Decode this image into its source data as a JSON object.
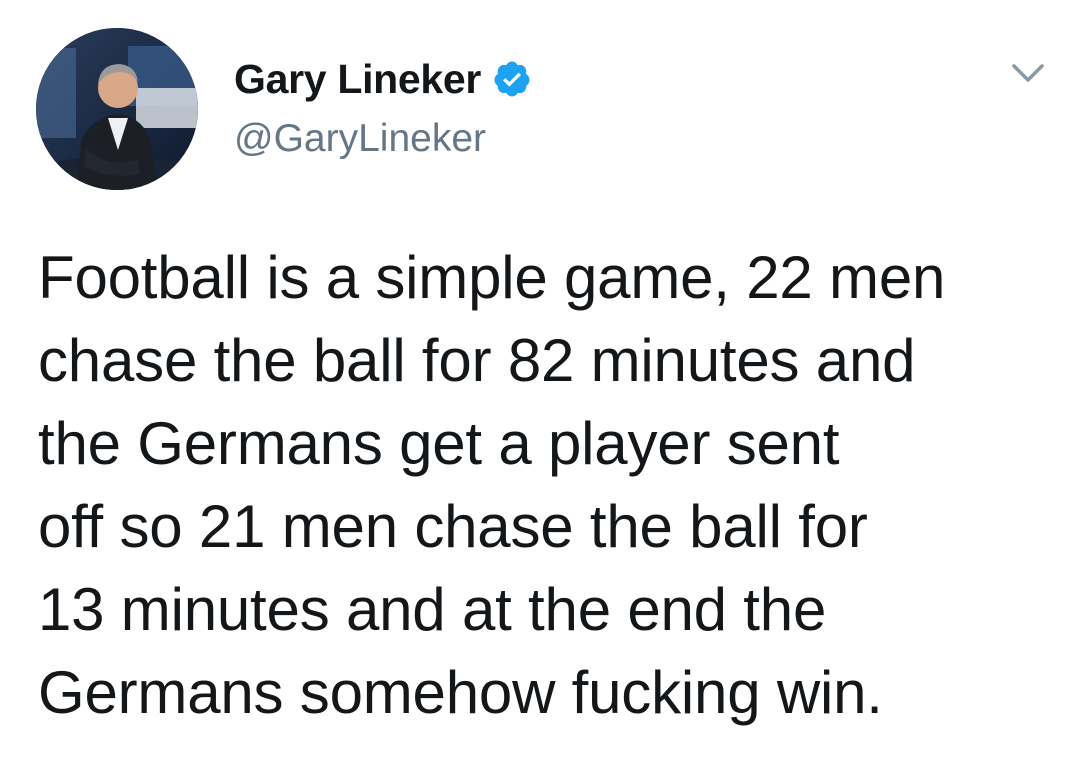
{
  "tweet": {
    "author": {
      "display_name": "Gary Lineker",
      "handle": "@GaryLineker",
      "verified": true,
      "avatar_icon": "profile-photo"
    },
    "menu_icon": "chevron-down-icon",
    "text": "Football is a simple game, 22 men\nchase the ball for 82 minutes and\nthe Germans get a player sent\noff so 21 men chase the ball for\n13 minutes and at the end the\nGermans somehow fucking win."
  },
  "colors": {
    "verified_badge": "#1da1f2",
    "handle_text": "#657786",
    "body_text": "#14171a",
    "caret": "#8899a6"
  }
}
